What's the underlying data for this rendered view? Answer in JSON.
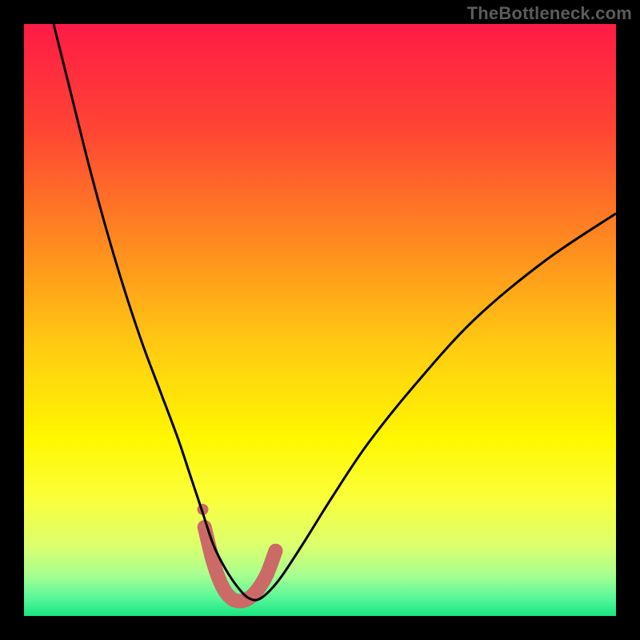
{
  "watermark": {
    "text": "TheBottleneck.com"
  },
  "chart_data": {
    "type": "line",
    "title": "",
    "xlabel": "",
    "ylabel": "",
    "xlim": [
      0,
      100
    ],
    "ylim": [
      0,
      100
    ],
    "grid": false,
    "legend": false,
    "annotations": [],
    "background_gradient_stops": [
      {
        "pct": 0.0,
        "color": "#ff1b46"
      },
      {
        "pct": 0.18,
        "color": "#ff4534"
      },
      {
        "pct": 0.38,
        "color": "#ff8e1e"
      },
      {
        "pct": 0.55,
        "color": "#ffcd11"
      },
      {
        "pct": 0.7,
        "color": "#fff700"
      },
      {
        "pct": 0.8,
        "color": "#fbff3a"
      },
      {
        "pct": 0.88,
        "color": "#dcff6d"
      },
      {
        "pct": 0.93,
        "color": "#a9ff8f"
      },
      {
        "pct": 0.97,
        "color": "#57f79a"
      },
      {
        "pct": 1.0,
        "color": "#18e47f"
      }
    ],
    "series": [
      {
        "name": "bottleneck-curve",
        "color": "#000000",
        "stroke_width": 3,
        "x": [
          5,
          8,
          11,
          14,
          17,
          20,
          23,
          26,
          28,
          30,
          32,
          34,
          36,
          38,
          40,
          43,
          47,
          52,
          58,
          66,
          76,
          88,
          100
        ],
        "values": [
          100,
          88,
          76,
          65,
          55,
          46,
          38,
          30,
          24,
          18,
          12,
          8,
          5,
          3,
          3,
          6,
          12,
          20,
          29,
          39,
          50,
          60,
          68
        ]
      },
      {
        "name": "valley-highlight",
        "color": "#cb6a66",
        "stroke_width": 18,
        "linecap": "round",
        "x": [
          30.5,
          32,
          33.5,
          35,
          36.5,
          38,
          39.5,
          41,
          42.5
        ],
        "values": [
          15,
          9,
          5,
          3,
          2.5,
          3,
          4.5,
          7,
          11
        ]
      }
    ],
    "markers": [
      {
        "x": 30.2,
        "y": 18,
        "r": 7,
        "color": "#cb6a66",
        "name": "valley-dot"
      }
    ]
  }
}
